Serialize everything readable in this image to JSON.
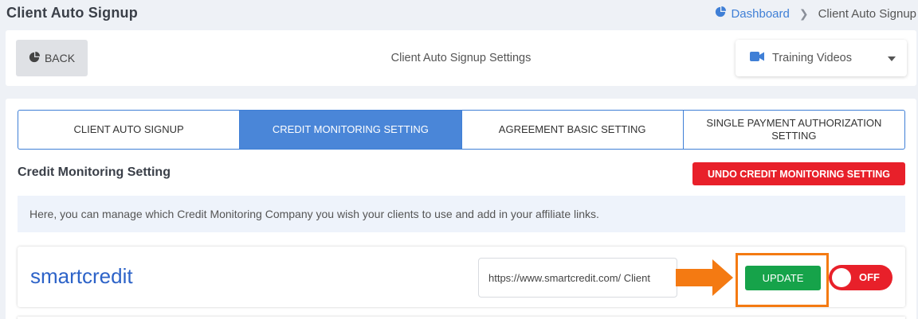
{
  "header": {
    "title": "Client Auto Signup",
    "breadcrumb": {
      "home_label": "Dashboard",
      "current_label": "Client Auto Signup"
    }
  },
  "top_bar": {
    "back_label": "BACK",
    "heading": "Client Auto Signup Settings",
    "videos_label": "Training Videos"
  },
  "tabs": [
    {
      "label": "CLIENT AUTO SIGNUP",
      "active": false
    },
    {
      "label": "CREDIT MONITORING SETTING",
      "active": true
    },
    {
      "label": "AGREEMENT BASIC SETTING",
      "active": false
    },
    {
      "label": "SINGLE PAYMENT AUTHORIZATION SETTING",
      "active": false
    }
  ],
  "section": {
    "title": "Credit Monitoring Setting",
    "undo_label": "UNDO CREDIT MONITORING SETTING",
    "info": "Here, you can manage which Credit Monitoring Company you wish your clients to use and add in your affiliate links."
  },
  "companies": [
    {
      "name": "smartcredit",
      "url_value": "https://www.smartcredit.com/ Client",
      "update_label": "UPDATE",
      "toggle_label": "OFF"
    }
  ],
  "colors": {
    "accent_blue": "#4a86d8",
    "danger_red": "#e8202a",
    "success_green": "#16a34a",
    "highlight_orange": "#f47a12"
  }
}
